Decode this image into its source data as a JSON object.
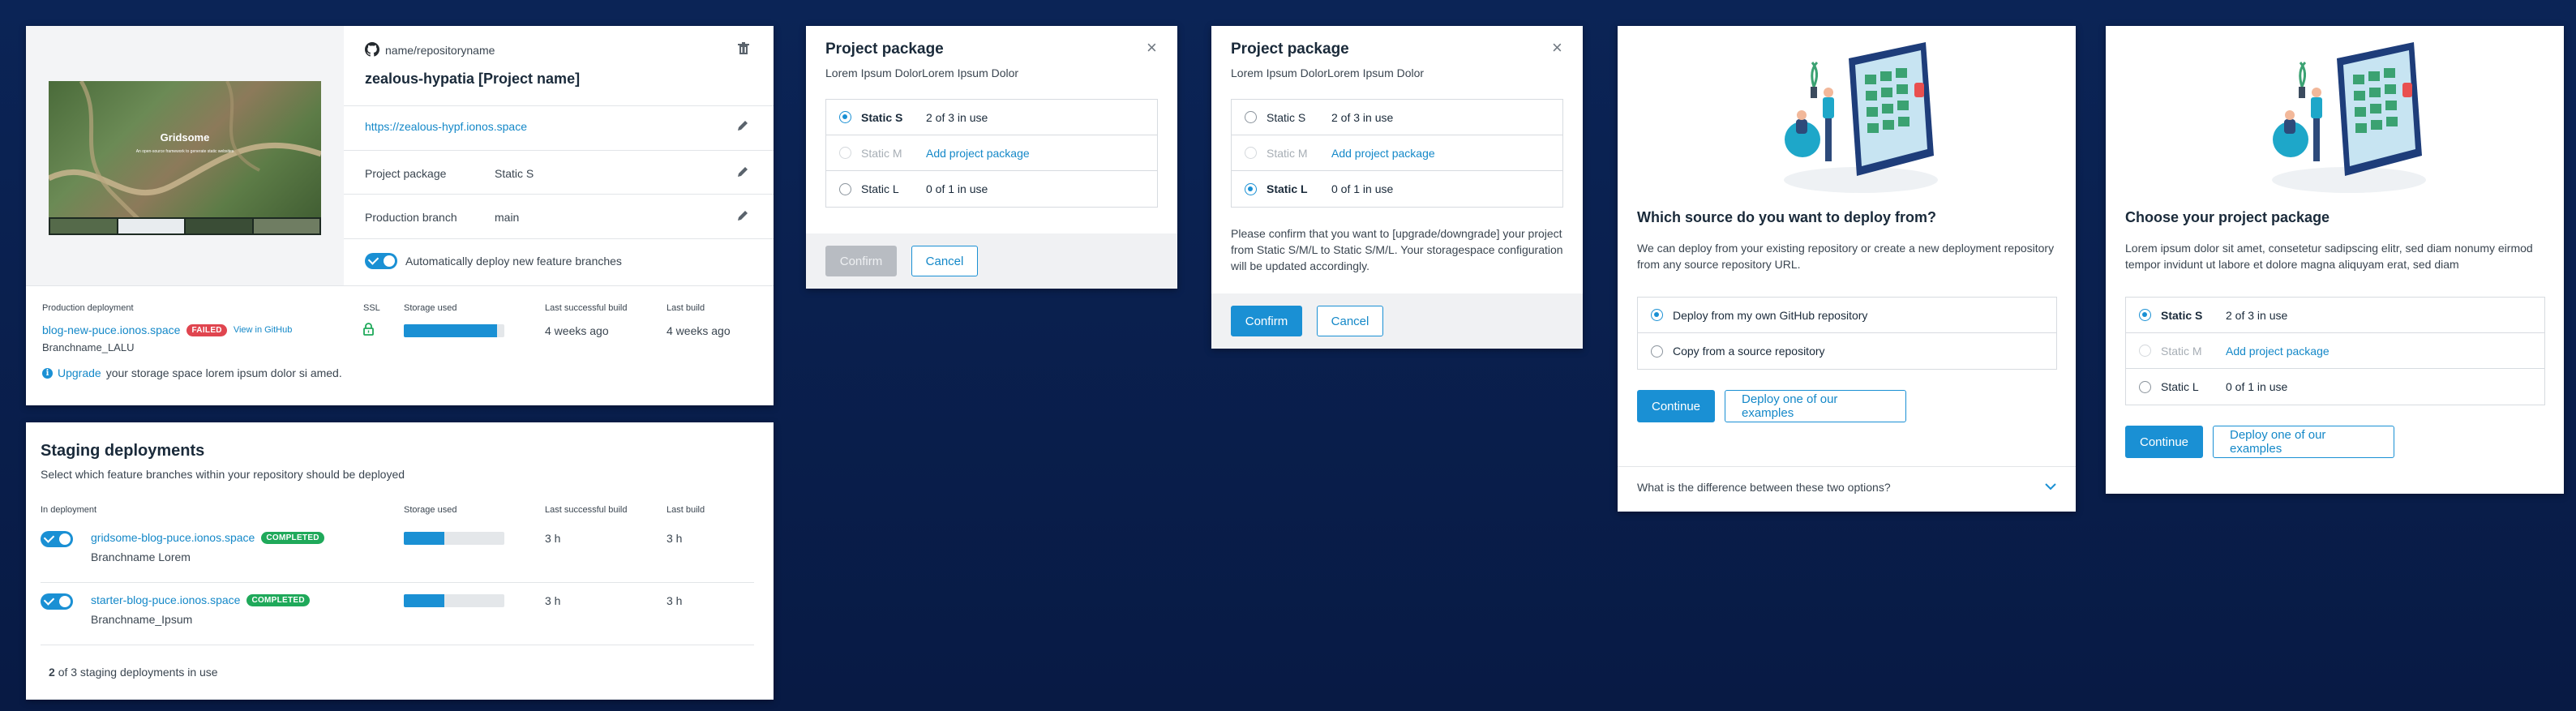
{
  "project_card": {
    "repo_name": "name/repositoryname",
    "project_title": "zealous-hypatia [Project name]",
    "project_url": "https://zealous-hypf.ionos.space",
    "package_label": "Project package",
    "package_value": "Static S",
    "branch_label": "Production branch",
    "branch_value": "main",
    "auto_deploy_label": "Automatically deploy new feature branches",
    "preview_title": "Gridsome",
    "preview_subtitle": "An open-source framework to generate static websites",
    "prod_header": "Production deployment",
    "ssl_header": "SSL",
    "storage_header": "Storage used",
    "last_success_header": "Last successful build",
    "last_build_header": "Last build",
    "prod_url": "blog-new-puce.ionos.space",
    "prod_status": "FAILED",
    "view_github": "View in GitHub",
    "prod_branch": "Branchname_LALU",
    "storage_fill": 0.93,
    "last_success": "4 weeks ago",
    "last_build": "4 weeks ago",
    "upgrade_link": "Upgrade",
    "upgrade_text": "your storage space lorem ipsum dolor si amed."
  },
  "staging": {
    "title": "Staging deployments",
    "subtitle": "Select which feature branches within your repository should be deployed",
    "col_in_deployment": "In deployment",
    "col_storage": "Storage used",
    "col_last_success": "Last successful build",
    "col_last_build": "Last build",
    "rows": [
      {
        "url": "gridsome-blog-puce.ionos.space",
        "status": "COMPLETED",
        "branch": "Branchname Lorem",
        "storage_fill": 0.4,
        "last_success": "3 h",
        "last_build": "3 h"
      },
      {
        "url": "starter-blog-puce.ionos.space",
        "status": "COMPLETED",
        "branch": "Branchname_Ipsum",
        "storage_fill": 0.4,
        "last_success": "3 h",
        "last_build": "3 h"
      }
    ],
    "footer_count": "2",
    "footer_text": "of 3 staging deployments in use"
  },
  "modal1": {
    "title": "Project package",
    "subtitle": "Lorem Ipsum DolorLorem Ipsum Dolor",
    "options": [
      {
        "name": "Static S",
        "info": "2 of 3 in use"
      },
      {
        "name": "Static M",
        "info": "Add project package"
      },
      {
        "name": "Static L",
        "info": "0 of 1 in use"
      }
    ],
    "confirm": "Confirm",
    "cancel": "Cancel"
  },
  "modal2": {
    "title": "Project package",
    "subtitle": "Lorem Ipsum DolorLorem Ipsum Dolor",
    "options": [
      {
        "name": "Static S",
        "info": "2 of 3 in use"
      },
      {
        "name": "Static M",
        "info": "Add project package"
      },
      {
        "name": "Static L",
        "info": "0 of 1 in use"
      }
    ],
    "message": "Please confirm that you want to [upgrade/downgrade] your project from Static S/M/L to Static S/M/L. Your storagespace configuration will be updated accordingly.",
    "confirm": "Confirm",
    "cancel": "Cancel"
  },
  "source_card": {
    "title": "Which source do you want to deploy from?",
    "description": "We can deploy from your existing repository or create a new deployment repository from any source repository URL.",
    "options": [
      "Deploy from my own GitHub repository",
      "Copy from a source repository"
    ],
    "continue": "Continue",
    "examples": "Deploy one of our examples",
    "faq": "What is the difference between these two options?"
  },
  "package_card": {
    "title": "Choose your project package",
    "description": "Lorem ipsum dolor sit amet, consetetur sadipscing elitr, sed diam nonumy eirmod tempor invidunt ut labore et dolore magna aliquyam erat, sed diam",
    "options": [
      {
        "name": "Static S",
        "info": "2 of 3 in use"
      },
      {
        "name": "Static M",
        "info": "Add project package"
      },
      {
        "name": "Static L",
        "info": "0 of 1 in use"
      }
    ],
    "continue": "Continue",
    "examples": "Deploy one of our examples"
  },
  "icons": [
    "github-icon",
    "trash-icon",
    "pencil-icon",
    "lock-icon",
    "info-icon",
    "close-icon",
    "chevron-down-icon"
  ],
  "colors": {
    "accent": "#1a90d4",
    "failed": "#e0454f",
    "completed": "#1fa95a",
    "background": "#0b2456"
  }
}
